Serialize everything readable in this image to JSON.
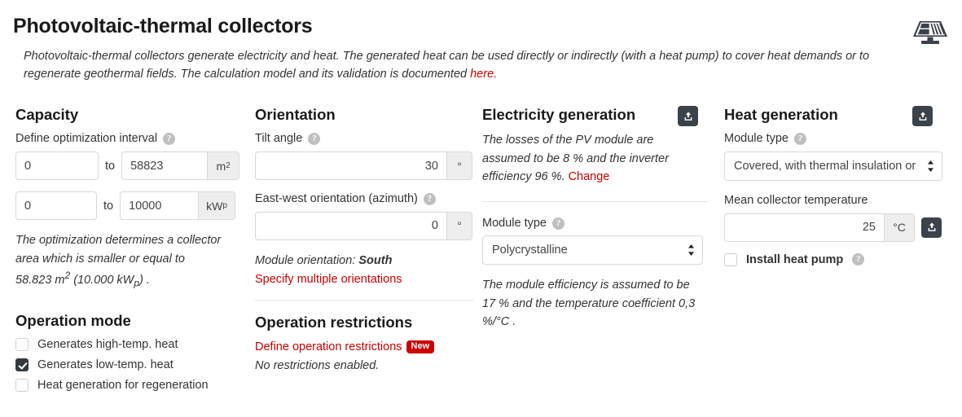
{
  "header": {
    "title": "Photovoltaic-thermal collectors",
    "description_part1": "Photovoltaic-thermal collectors generate electricity and heat. The generated heat can be used directly or indirectly (with a heat pump) to cover heat demands or to regenerate geothermal fields. The calculation model and its validation is documented ",
    "description_link": "here",
    "description_part2": ".",
    "icon": "solar-panel-icon"
  },
  "capacity": {
    "heading": "Capacity",
    "interval_label": "Define optimization interval",
    "help_icon": "help-icon",
    "row_area": {
      "from_value": "0",
      "to_label": "to",
      "to_value": "58823",
      "unit": "m",
      "unit_sup": "2"
    },
    "row_power": {
      "from_value": "0",
      "to_label": "to",
      "to_value": "10000",
      "unit": "kW",
      "unit_sub": "p"
    },
    "note_line1": "The optimization determines a collector",
    "note_line2": "area which is smaller or equal to",
    "note_line3_a": "58.823 m",
    "note_line3_sup": "2",
    "note_line3_b": " (10.000 kW",
    "note_line3_sub": "p",
    "note_line3_c": ") ."
  },
  "operation_mode": {
    "heading": "Operation mode",
    "items": [
      {
        "label": "Generates high-temp. heat",
        "checked": false
      },
      {
        "label": "Generates low-temp. heat",
        "checked": true
      },
      {
        "label": "Heat generation for regeneration",
        "checked": false
      }
    ]
  },
  "orientation": {
    "heading": "Orientation",
    "tilt_label": "Tilt angle",
    "tilt_value": "30",
    "tilt_unit": "°",
    "azimuth_label": "East-west orientation (azimuth)",
    "azimuth_value": "0",
    "azimuth_unit": "°",
    "module_orientation_prefix": "Module orientation: ",
    "module_orientation_value": "South",
    "multiple_orientations_link": "Specify multiple orientations"
  },
  "operation_restrictions": {
    "heading": "Operation restrictions",
    "define_link": "Define operation restrictions",
    "badge": "New",
    "status": "No restrictions enabled."
  },
  "electricity": {
    "heading": "Electricity generation",
    "export_icon": "export-icon",
    "losses_text_a": "The losses of the PV module are assumed to be 8 % and the inverter efficiency 96 %. ",
    "losses_change_link": "Change",
    "module_type_label": "Module type",
    "module_type_value": "Polycrystalline",
    "efficiency_note": "The module efficiency is assumed to be 17 % and the temperature coefficient 0,3 %/°C ."
  },
  "heat": {
    "heading": "Heat generation",
    "export_icon": "export-icon",
    "module_type_label": "Module type",
    "module_type_value": "Covered, with thermal insulation or",
    "mean_temp_label": "Mean collector temperature",
    "mean_temp_value": "25",
    "mean_temp_unit": "°C",
    "temp_export_icon": "export-icon",
    "heat_pump_label": "Install heat pump",
    "heat_pump_checked": false
  },
  "colors": {
    "accent_red": "#cc0000",
    "dark": "#3b424b",
    "text": "#333333"
  }
}
